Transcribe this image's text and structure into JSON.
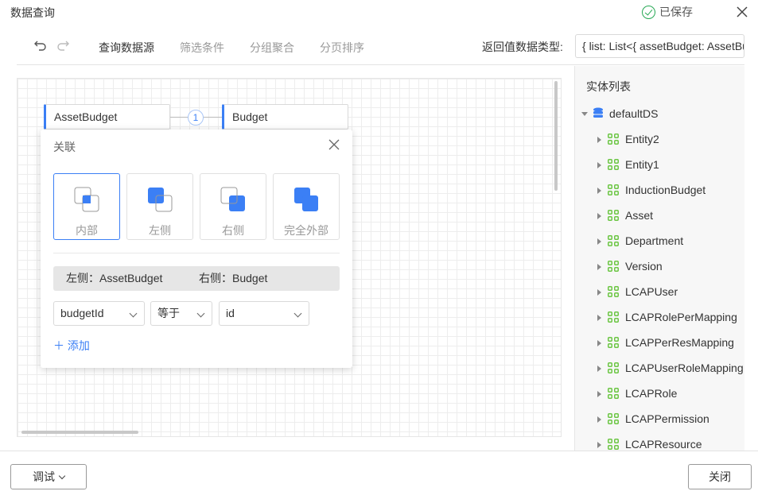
{
  "window": {
    "title": "数据查询",
    "saved_text": "已保存"
  },
  "toolbar": {
    "tabs": [
      {
        "label": "查询数据源",
        "active": true
      },
      {
        "label": "筛选条件",
        "active": false
      },
      {
        "label": "分组聚合",
        "active": false
      },
      {
        "label": "分页排序",
        "active": false
      }
    ],
    "return_type_label": "返回值数据类型:",
    "return_type_value": "{ list: List<{ assetBudget: AssetBudget, budget: Budget }>, total: Long }"
  },
  "canvas": {
    "left_entity": "AssetBudget",
    "right_entity": "Budget",
    "link_count": "1"
  },
  "join_popup": {
    "title": "关联",
    "join_types": [
      {
        "label": "内部",
        "active": true
      },
      {
        "label": "左侧",
        "active": false
      },
      {
        "label": "右侧",
        "active": false
      },
      {
        "label": "完全外部",
        "active": false
      }
    ],
    "left_side": "左侧：AssetBudget",
    "right_side": "右侧：Budget",
    "condition": {
      "left_field": "budgetId",
      "operator": "等于",
      "right_field": "id"
    },
    "add_label": "添加"
  },
  "entity_panel": {
    "title": "实体列表",
    "datasource": "defaultDS",
    "entities": [
      "Entity2",
      "Entity1",
      "InductionBudget",
      "Asset",
      "Department",
      "Version",
      "LCAPUser",
      "LCAPRolePerMapping",
      "LCAPPerResMapping",
      "LCAPUserRoleMapping",
      "LCAPRole",
      "LCAPPermission",
      "LCAPResource"
    ]
  },
  "footer": {
    "debug_label": "调试",
    "close_label": "关闭"
  },
  "colors": {
    "accent": "#3b7ff5",
    "entity_icon": "#6cc644",
    "saved": "#26a854"
  }
}
